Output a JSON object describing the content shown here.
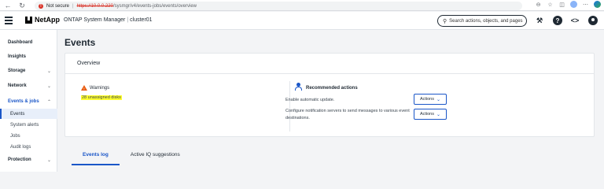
{
  "browser": {
    "security_label": "Not secure",
    "url_host": "https://10.0.0.220",
    "url_rest": "/sysmgr/v4/events-jobs/events/overview"
  },
  "app": {
    "brand": "NetApp",
    "product": "ONTAP System Manager",
    "cluster": "cluster01",
    "search_placeholder": "Search actions, objects, and pages"
  },
  "sidebar": {
    "items": [
      {
        "label": "Dashboard"
      },
      {
        "label": "Insights"
      },
      {
        "label": "Storage"
      },
      {
        "label": "Network"
      },
      {
        "label": "Events & jobs"
      },
      {
        "label": "Protection"
      }
    ],
    "subitems": [
      {
        "label": "Events"
      },
      {
        "label": "System alerts"
      },
      {
        "label": "Jobs"
      },
      {
        "label": "Audit logs"
      }
    ]
  },
  "main": {
    "title": "Events",
    "overview": {
      "heading": "Overview",
      "warnings_title": "Warnings",
      "warning_item": "28 unassigned disks",
      "recommended_title": "Recommended actions",
      "recommendations": [
        {
          "text": "Enable automatic update.",
          "button": "Actions"
        },
        {
          "text": "Configure notification servers to send messages to various event destinations.",
          "button": "Actions"
        }
      ]
    },
    "tabs": [
      {
        "label": "Events log"
      },
      {
        "label": "Active IQ suggestions"
      }
    ]
  },
  "colors": {
    "accent": "#1a56c8",
    "warning": "#e8590c",
    "highlight": "#ffff2d"
  }
}
